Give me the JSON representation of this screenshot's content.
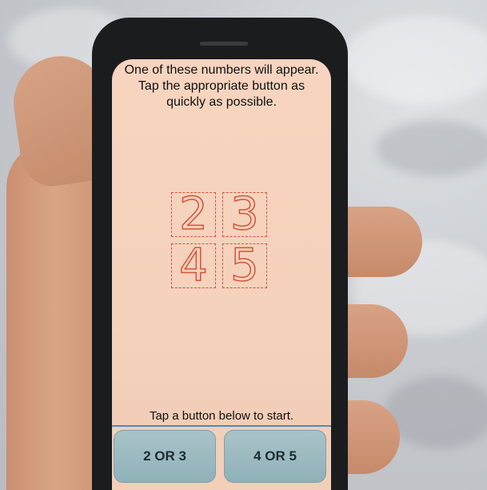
{
  "screen": {
    "instructions": "One of these numbers will appear.\nTap the appropriate button as\nquickly as possible.",
    "digits": [
      "2",
      "3",
      "4",
      "5"
    ],
    "start_hint": "Tap a button below to start.",
    "buttons": {
      "left_label": "2 OR 3",
      "right_label": "4 OR 5"
    },
    "colors": {
      "background": "#f4d2bc",
      "digit_outline": "#d4543a",
      "button": "#9bb8bf",
      "divider": "#4d8bb6"
    }
  }
}
